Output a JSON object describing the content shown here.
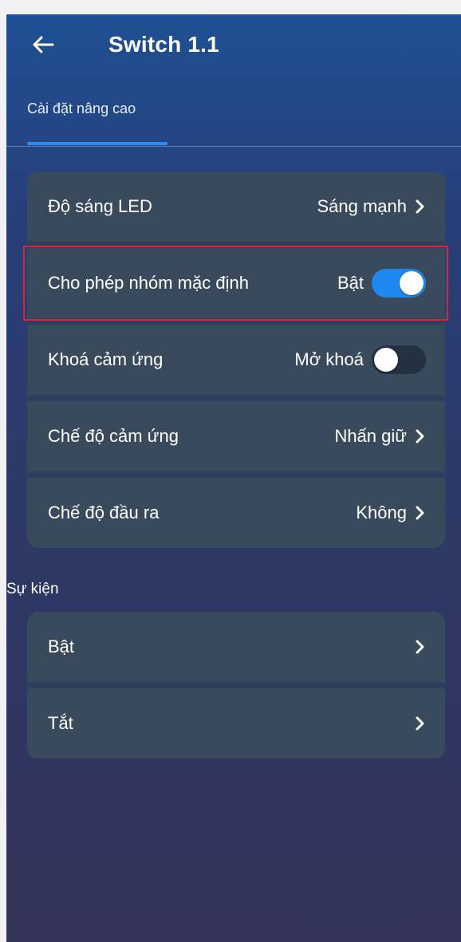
{
  "header": {
    "title": "Switch 1.1",
    "back_icon": "arrow-left-icon"
  },
  "tabs": [
    {
      "label": "Cài đặt nâng cao",
      "active": true
    }
  ],
  "settings": [
    {
      "label": "Độ sáng LED",
      "value": "Sáng mạnh",
      "control": "chevron"
    },
    {
      "label": "Cho phép nhóm mặc định",
      "value": "Bật",
      "control": "toggle",
      "toggle_on": true
    },
    {
      "label": "Khoá cảm ứng",
      "value": "Mở khoá",
      "control": "toggle",
      "toggle_on": false
    },
    {
      "label": "Chế độ cảm ứng",
      "value": "Nhấn giữ",
      "control": "chevron"
    },
    {
      "label": "Chế độ đầu ra",
      "value": "Không",
      "control": "chevron"
    }
  ],
  "events_section": {
    "title": "Sự kiện",
    "items": [
      {
        "label": "Bật",
        "control": "chevron"
      },
      {
        "label": "Tắt",
        "control": "chevron"
      }
    ]
  },
  "colors": {
    "accent": "#1e88f0",
    "card": "#384a5c",
    "highlight": "#e0262b"
  }
}
